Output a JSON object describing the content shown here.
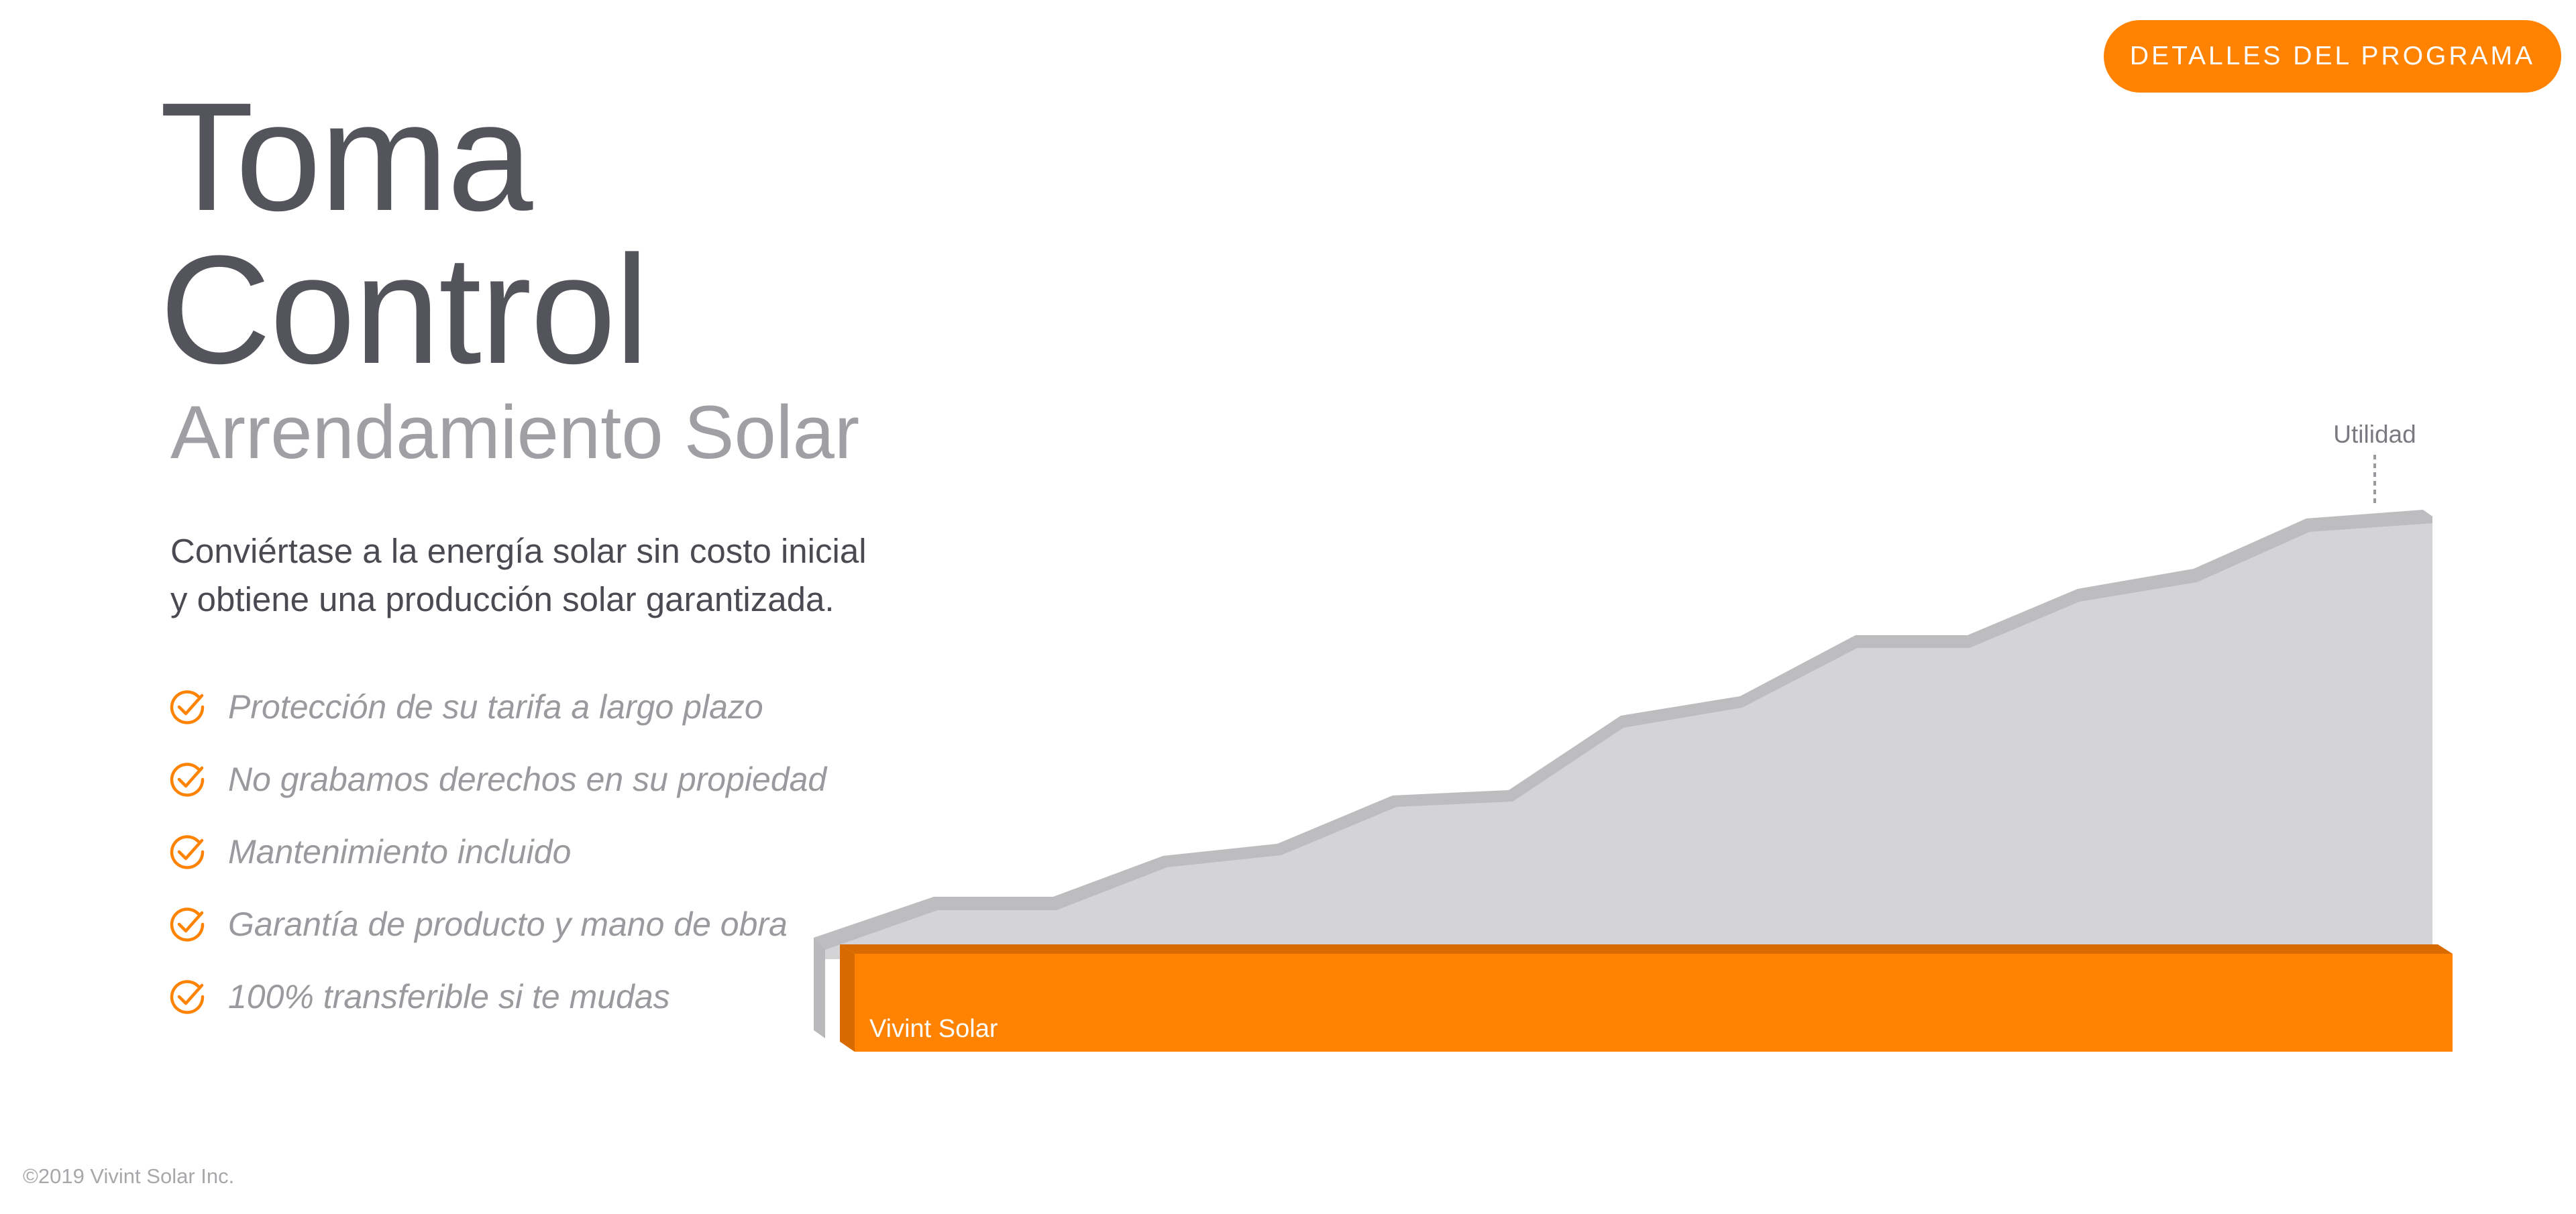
{
  "header": {
    "cta_label": "DETALLES DEL PROGRAMA"
  },
  "hero": {
    "title_line1": "Toma",
    "title_line2": "Control",
    "subtitle": "Arrendamiento Solar",
    "lead_line1": "Conviértase a la energía solar sin costo inicial",
    "lead_line2": "y obtiene una producción solar garantizada."
  },
  "benefits": [
    {
      "icon": "check-circle-icon",
      "label": "Protección de su tarifa a largo plazo"
    },
    {
      "icon": "check-circle-icon",
      "label": "No grabamos derechos en su propiedad"
    },
    {
      "icon": "check-circle-icon",
      "label": "Mantenimiento incluido"
    },
    {
      "icon": "check-circle-icon",
      "label": "Garantía de producto y mano de obra"
    },
    {
      "icon": "check-circle-icon",
      "label": "100% transferible si te mudas"
    }
  ],
  "chart_data": {
    "type": "area",
    "title": "",
    "xlabel": "",
    "ylabel": "",
    "grid": false,
    "series": [
      {
        "name": "Utilidad",
        "color": "#d4d4d6",
        "shape": "rising-steps"
      },
      {
        "name": "Vivint Solar",
        "color": "#ff8200",
        "shape": "flat"
      }
    ]
  },
  "colors": {
    "accent": "#ff8200",
    "accent_dark": "#d86a00",
    "title_text": "#54545c",
    "muted_text": "#9a9a9e",
    "utility_fill": "#d4d4d6",
    "utility_edge": "#bdbdbf"
  },
  "footer": {
    "copyright": "©2019 Vivint Solar Inc."
  }
}
